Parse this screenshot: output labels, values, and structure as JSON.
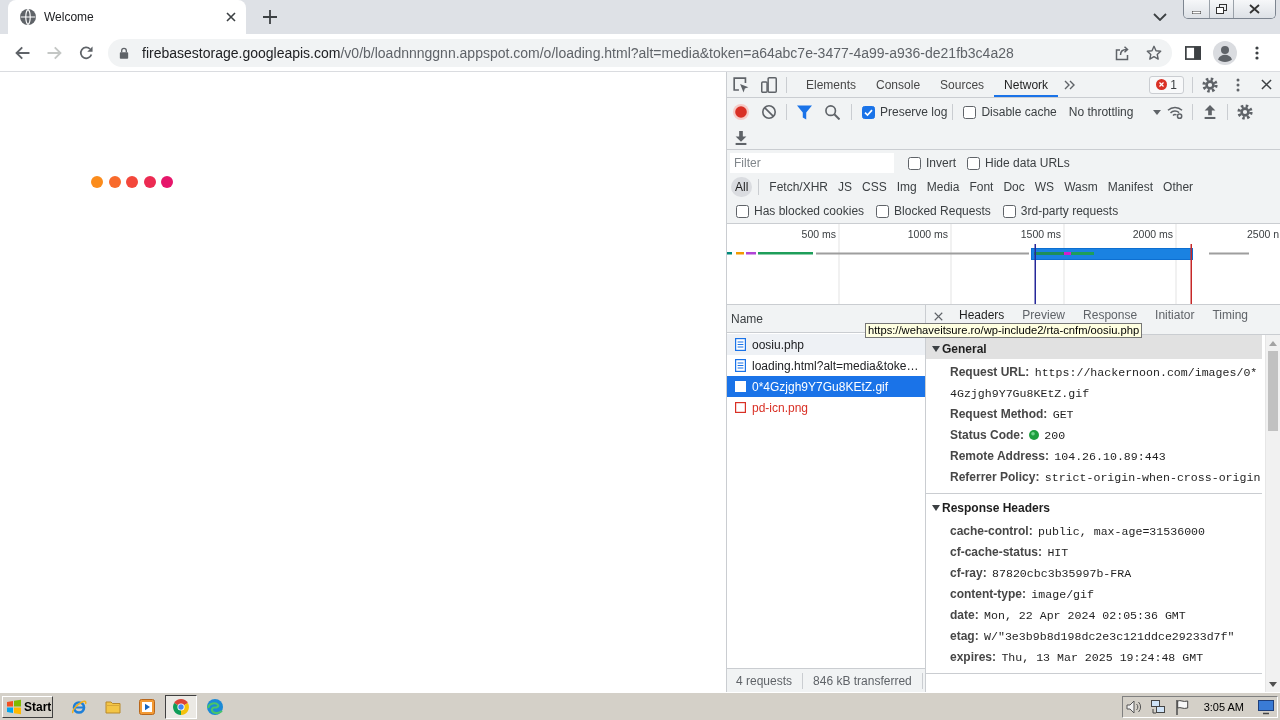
{
  "browser": {
    "tabs": [
      {
        "title": "Welcome",
        "selected": true
      }
    ],
    "navigation": [
      {
        "disabled": false
      },
      {
        "disabled": true
      },
      {
        "disabled": false
      }
    ],
    "url": {
      "host": "firebasestorage.googleapis.com",
      "path": "/v0/b/loadnnnggnn.appspot.com/o/loading.html?alt=media&token=a64abc7e-3477-4a99-a936-de21fb3c4a28"
    }
  },
  "page": {
    "loader_dots": [
      {
        "color": "#fb8c1c"
      },
      {
        "color": "#f86a2b"
      },
      {
        "color": "#f3473b"
      },
      {
        "color": "#ec2b52"
      },
      {
        "color": "#e6166b"
      }
    ]
  },
  "devtools": {
    "panels": [
      {
        "label": "Elements",
        "selected": false
      },
      {
        "label": "Console",
        "selected": false
      },
      {
        "label": "Sources",
        "selected": false
      },
      {
        "label": "Network",
        "selected": true
      }
    ],
    "error_count": "1",
    "toolbar": {
      "recording": true,
      "options": [
        {
          "label": "Preserve log",
          "checked": true
        },
        {
          "label": "Disable cache",
          "checked": false
        }
      ],
      "throttling": "No throttling"
    },
    "filter": {
      "placeholder": "Filter",
      "options": [
        {
          "label": "Invert",
          "checked": false
        },
        {
          "label": "Hide data URLs",
          "checked": false
        }
      ]
    },
    "resource_types": [
      {
        "label": "All",
        "selected": true
      },
      {
        "label": "Fetch/XHR",
        "selected": false
      },
      {
        "label": "JS",
        "selected": false
      },
      {
        "label": "CSS",
        "selected": false
      },
      {
        "label": "Img",
        "selected": false
      },
      {
        "label": "Media",
        "selected": false
      },
      {
        "label": "Font",
        "selected": false
      },
      {
        "label": "Doc",
        "selected": false
      },
      {
        "label": "WS",
        "selected": false
      },
      {
        "label": "Wasm",
        "selected": false
      },
      {
        "label": "Manifest",
        "selected": false
      },
      {
        "label": "Other",
        "selected": false
      }
    ],
    "request_filters": [
      {
        "label": "Has blocked cookies",
        "checked": false
      },
      {
        "label": "Blocked Requests",
        "checked": false
      },
      {
        "label": "3rd-party requests",
        "checked": false
      }
    ],
    "overview": {
      "ticks": [
        "500 ms",
        "1000 ms",
        "1500 ms",
        "2000 ms",
        "2500 n"
      ]
    },
    "requests": {
      "column": "Name",
      "rows": [
        {
          "name": "oosiu.php",
          "kind": "document",
          "hovered": true,
          "selected": false,
          "failed": false
        },
        {
          "name": "loading.html?alt=media&toke…",
          "kind": "document",
          "hovered": false,
          "selected": false,
          "failed": false
        },
        {
          "name": "0*4Gzjgh9Y7Gu8KEtZ.gif",
          "kind": "image",
          "hovered": false,
          "selected": true,
          "failed": false
        },
        {
          "name": "pd-icn.png",
          "kind": "image",
          "hovered": false,
          "selected": false,
          "failed": true
        }
      ],
      "summary": [
        "4 requests",
        "846 kB transferred"
      ]
    },
    "tooltip": "https://wehaveitsure.ro/wp-include2/rta-cnfm/oosiu.php",
    "details": {
      "tabs": [
        {
          "label": "Headers",
          "selected": true
        },
        {
          "label": "Preview",
          "selected": false
        },
        {
          "label": "Response",
          "selected": false
        },
        {
          "label": "Initiator",
          "selected": false
        },
        {
          "label": "Timing",
          "selected": false
        }
      ],
      "sections": [
        {
          "title": "General",
          "expanded": true,
          "highlighted": true,
          "rows": [
            {
              "key": "Request URL:",
              "value": "https://hackernoon.com/images/0*4Gzjgh9Y7Gu8KEtZ.gif",
              "kind": "text"
            },
            {
              "key": "Request Method:",
              "value": "GET",
              "kind": "text"
            },
            {
              "key": "Status Code:",
              "value": "200",
              "kind": "status"
            },
            {
              "key": "Remote Address:",
              "value": "104.26.10.89:443",
              "kind": "text"
            },
            {
              "key": "Referrer Policy:",
              "value": "strict-origin-when-cross-origin",
              "kind": "text"
            }
          ]
        },
        {
          "title": "Response Headers",
          "expanded": true,
          "highlighted": false,
          "rows": [
            {
              "key": "cache-control:",
              "value": "public, max-age=31536000",
              "kind": "text"
            },
            {
              "key": "cf-cache-status:",
              "value": "HIT",
              "kind": "text"
            },
            {
              "key": "cf-ray:",
              "value": "87820cbc3b35997b-FRA",
              "kind": "text"
            },
            {
              "key": "content-type:",
              "value": "image/gif",
              "kind": "text"
            },
            {
              "key": "date:",
              "value": "Mon, 22 Apr 2024 02:05:36 GMT",
              "kind": "text"
            },
            {
              "key": "etag:",
              "value": "W/\"3e3b9b8d198dc2e3c121ddce29233d7f\"",
              "kind": "text"
            },
            {
              "key": "expires:",
              "value": "Thu, 13 Mar 2025 19:24:48 GMT",
              "kind": "text"
            }
          ]
        }
      ]
    }
  },
  "taskbar": {
    "start": "Start",
    "apps": [
      {
        "selected": false
      },
      {
        "selected": false
      },
      {
        "selected": false
      },
      {
        "selected": true
      },
      {
        "selected": false
      }
    ],
    "clock": "3:05 AM"
  }
}
